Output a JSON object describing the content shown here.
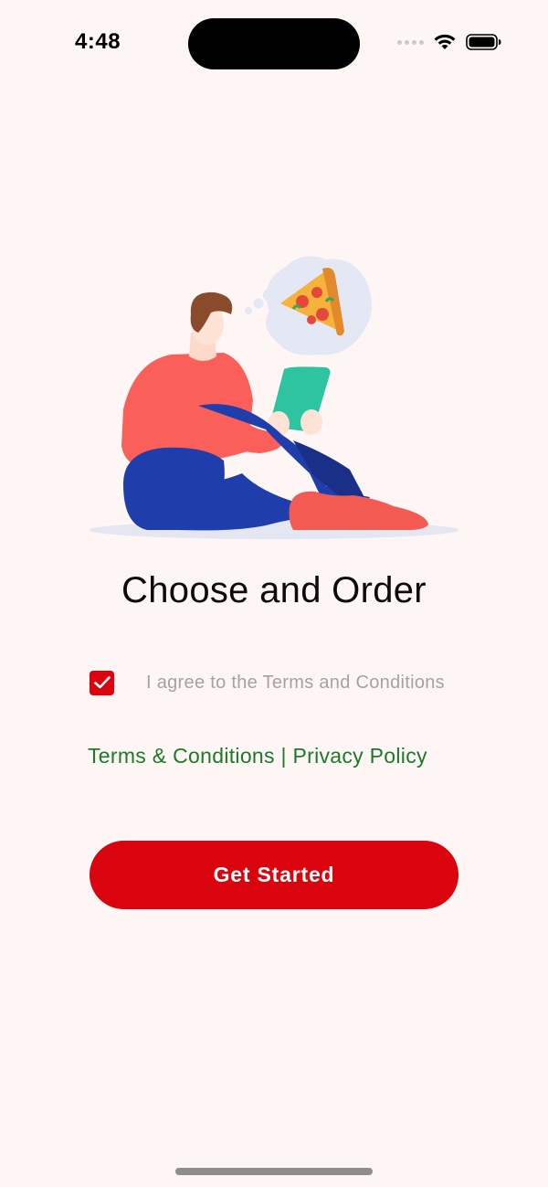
{
  "status_bar": {
    "time": "4:48",
    "icons": [
      "signal-dots-icon",
      "wifi-icon",
      "battery-icon"
    ]
  },
  "illustration": {
    "subject": "person-with-tablet-thinking-of-pizza"
  },
  "onboarding": {
    "title": "Choose and Order",
    "agree_checkbox": {
      "checked": true,
      "label": "I agree to the Terms and Conditions"
    },
    "links": {
      "terms": "Terms & Conditions",
      "separator": " | ",
      "privacy": "Privacy Policy"
    },
    "cta_label": "Get Started"
  },
  "colors": {
    "background": "#fdf6f5",
    "primary": "#d9040d",
    "link": "#1c7a2a",
    "muted_text": "#a7a2a2"
  }
}
